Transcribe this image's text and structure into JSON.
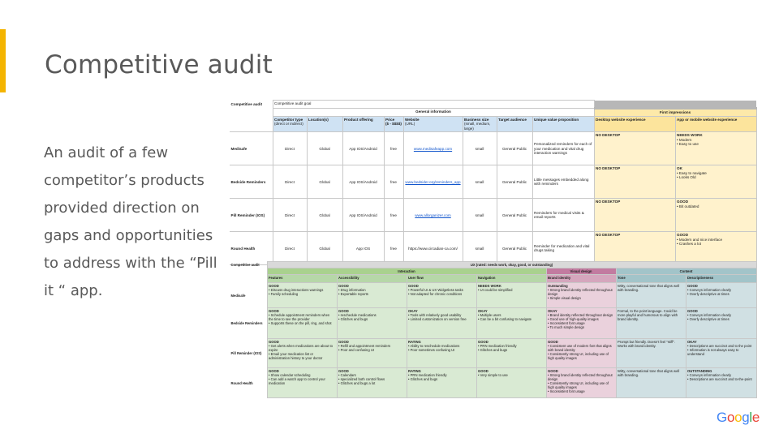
{
  "slide": {
    "title": "Competitive audit",
    "body": "An audit of a few competitor’s products provided direction on gaps and opportunities to address with the “Pill it “ app.",
    "accent_color": "#F4B400",
    "logo_letters": [
      "G",
      "o",
      "o",
      "g",
      "l",
      "e"
    ],
    "logo_colors": [
      "#4285F4",
      "#EA4335",
      "#FBBC05",
      "#4285F4",
      "#34A853",
      "#EA4335"
    ]
  },
  "table1": {
    "title": "Competitive audit",
    "goal": "Competitive audit goal",
    "general_info": "General information",
    "first_impressions": "First impressions",
    "headers": {
      "type": "Competitor type",
      "type_sub": "(direct or indirect)",
      "location": "Location(s)",
      "offering": "Product offering",
      "price": "Price",
      "price_sub": "($ - $$$$)",
      "website": "Website",
      "website_sub": "(URL)",
      "size": "Business size",
      "size_sub": "(small, medium, large)",
      "audience": "Target audience",
      "value": "Unique value proposition",
      "desktop": "Desktop website experience",
      "mobile": "App or mobile website experience"
    },
    "rows": [
      {
        "name": "Medisafe",
        "type": "Direct",
        "location": "Global",
        "offering": "App IOS/Android",
        "price": "free",
        "website": "www.medisafeapp.com",
        "size": "small",
        "audience": "General Public",
        "value": "Personalized reminders for each of your medication and vital drug interaction warnings",
        "desktop": "NO DESKTOP",
        "mobile_head": "NEEDS WORK",
        "mobile_body": "• Modern\n• Easy to use"
      },
      {
        "name": "Bedside Reminders",
        "type": "Direct",
        "location": "Global",
        "offering": "App IOS/Android",
        "price": "free",
        "website": "www.bedsider.org/reminders_app",
        "size": "small",
        "audience": "General Public",
        "value": "Little messages embedded along with reminders",
        "desktop": "NO DESKTOP",
        "mobile_head": "OK",
        "mobile_body": "• Easy to navigate\n• Looks Old"
      },
      {
        "name": "Pill Reminder (IOS)",
        "type": "Direct",
        "location": "Global",
        "offering": "App IOS/Android",
        "price": "free",
        "website": "www.allorganizer.com",
        "size": "small",
        "audience": "General Public",
        "value": "Reminders for medical visits & email reports",
        "desktop": "NO DESKTOP",
        "mobile_head": "GOOD",
        "mobile_body": "• Bit outdated"
      },
      {
        "name": "Round Health",
        "type": "Direct",
        "location": "Global",
        "offering": "App IOS",
        "price": "free",
        "website": "https://www.circadian-ca.com/",
        "size": "small",
        "audience": "General Public",
        "value": "Reminder for medication and vital drugs taking",
        "desktop": "NO DESKTOP",
        "mobile_head": "GOOD",
        "mobile_body": "• Modern and nice interface\n• Crashes a lot"
      }
    ]
  },
  "table2": {
    "title": "Competitive audit",
    "ux_header": "UX (rated: needs work, okay, good, or outstanding)",
    "interaction": "Interaction",
    "visual_design": "Visual design",
    "content": "Content",
    "headers": {
      "features": "Features",
      "accessibility": "Accessibility",
      "user_flow": "User flow",
      "navigation": "Navigation",
      "brand": "Brand identity",
      "tone": "Tone",
      "descriptiveness": "Descriptiveness"
    },
    "rows": [
      {
        "name": "Medisafe",
        "features_h": "GOOD",
        "features": "• Discuss drug interactions warnings\n• Family scheduling",
        "access_h": "GOOD",
        "access": "• Drug information\n• Exportable reports",
        "flow_h": "GOOD",
        "flow": "• Powerful UI & UX Widgetless tasks\n• Not adapted for chronic conditions",
        "nav_h": "NEEDS WORK",
        "nav": "• UI could be simplified",
        "brand_h": "Outstanding",
        "brand": "• Strong brand identity reflected throughout design\n• Simple visual design",
        "tone": "Witty, conversational tone that aligns well with branding.",
        "desc_h": "GOOD",
        "desc": "• Conveys information clearly\n• Overly descriptive at times"
      },
      {
        "name": "Bedside Reminders",
        "features_h": "GOOD",
        "features": "• Schedule appointment reminders when the time to see the provider\n• Supports these on the pill, ring, and shot",
        "access_h": "GOOD",
        "access": "• reschedule medications\n• Glitches and bugs",
        "flow_h": "OKAY",
        "flow": "• Tools with relatively good usability\n• Limited customization on version free",
        "nav_h": "OKAY",
        "nav": "• Multiple users\n• Can be a bit confusing to navigate",
        "brand_h": "OKAY",
        "brand": "• Brand identity reflected throughout design\n• Good use of high-quality images\n• Inconsistent font usage\n• To much simple design",
        "tone": "Formal, to the point language. Could be more playful and humorous to align with brand identity.",
        "desc_h": "GOOD",
        "desc": "• Conveys information clearly\n• Overly descriptive at times"
      },
      {
        "name": "Pill Reminder (IOS)",
        "features_h": "GOOD",
        "features": "• Get alerts when medications are about to expire\n• Email your medication list or administration history to your doctor",
        "access_h": "GOOD",
        "access": "• Refill and appointment reminders\n• Poor and confusing UI",
        "flow_h": "RATING",
        "flow": "• Ability to reschedule medications\n• Poor sometimes confusing UI",
        "nav_h": "GOOD",
        "nav": "• PRN medication friendly\n• Glitches and bugs",
        "brand_h": "GOOD",
        "brand": "• Consistent use of modern font that aligns with brand identity\n• Consistently strong UI, including use of high quality images",
        "tone": "Prompt but friendly. Doesn't feel \"stiff\". Works with brand identity.",
        "desc_h": "OKAY",
        "desc": "• Descriptions are succinct and to the point\n• Information is not always easy to understand"
      },
      {
        "name": "Round Health",
        "features_h": "GOOD",
        "features": "• Show calendar scheduling\n• Can add a watch app to control your medication",
        "access_h": "GOOD",
        "access": "• Calendars\n• specialized both control flows\n• Glitches and bugs a lot",
        "flow_h": "RATING",
        "flow": "• PRN medication friendly\n• Glitches and bugs",
        "nav_h": "GOOD",
        "nav": "• Very simple to use",
        "brand_h": "GOOD",
        "brand": "• Strong brand identity reflected throughout design\n• Consistently strong UI, including use of high quality images\n• Inconsistent font usage",
        "tone": "Witty, conversational tone that aligns well with branding.",
        "desc_h": "OUTSTANDING",
        "desc": "• Conveys information clearly\n• Descriptions are succinct and to-the-point"
      }
    ]
  }
}
